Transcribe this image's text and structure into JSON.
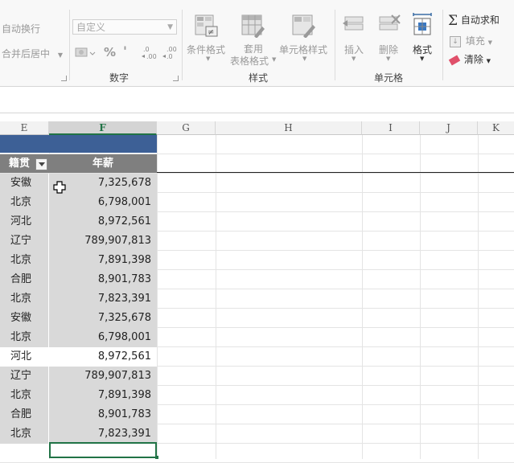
{
  "ribbon": {
    "alignment": {
      "wrap_text": "自动换行",
      "merge_center": "合并后居中"
    },
    "number": {
      "format_value": "自定义",
      "percent_symbol": "%",
      "comma_symbol": "'",
      "increase_decimal": "←.0\n.00",
      "decrease_decimal": ".00\n→.0",
      "group_label": "数字"
    },
    "styles": {
      "conditional_formatting": "条件格式",
      "format_as_table_line1": "套用",
      "format_as_table_line2": "表格格式",
      "cell_styles": "单元格样式",
      "group_label": "样式"
    },
    "cells": {
      "insert": "插入",
      "delete": "删除",
      "format": "格式",
      "group_label": "单元格"
    },
    "editing": {
      "autosum": "自动求和",
      "fill": "填充",
      "clear": "清除"
    }
  },
  "columns": [
    {
      "label": "E"
    },
    {
      "label": "F"
    },
    {
      "label": "G"
    },
    {
      "label": "H"
    },
    {
      "label": "I"
    },
    {
      "label": "J"
    },
    {
      "label": "K"
    }
  ],
  "table": {
    "header_native": "籍贯",
    "header_salary": "年薪",
    "rows": [
      {
        "native": "安徽",
        "salary": "7,325,678"
      },
      {
        "native": "北京",
        "salary": "6,798,001"
      },
      {
        "native": "河北",
        "salary": "8,972,561"
      },
      {
        "native": "辽宁",
        "salary": "789,907,813"
      },
      {
        "native": "北京",
        "salary": "7,891,398"
      },
      {
        "native": "合肥",
        "salary": "8,901,783"
      },
      {
        "native": "北京",
        "salary": "7,823,391"
      },
      {
        "native": "安徽",
        "salary": "7,325,678"
      },
      {
        "native": "北京",
        "salary": "6,798,001"
      },
      {
        "native": "河北",
        "salary": "8,972,561"
      },
      {
        "native": "辽宁",
        "salary": "789,907,813"
      },
      {
        "native": "北京",
        "salary": "7,891,398"
      },
      {
        "native": "合肥",
        "salary": "8,901,783"
      },
      {
        "native": "北京",
        "salary": "7,823,391"
      }
    ]
  },
  "colors": {
    "title_band": "#3d6096",
    "header_band": "#7f7f7f",
    "row_shade": "#d9d9d9",
    "selection": "#217346"
  }
}
